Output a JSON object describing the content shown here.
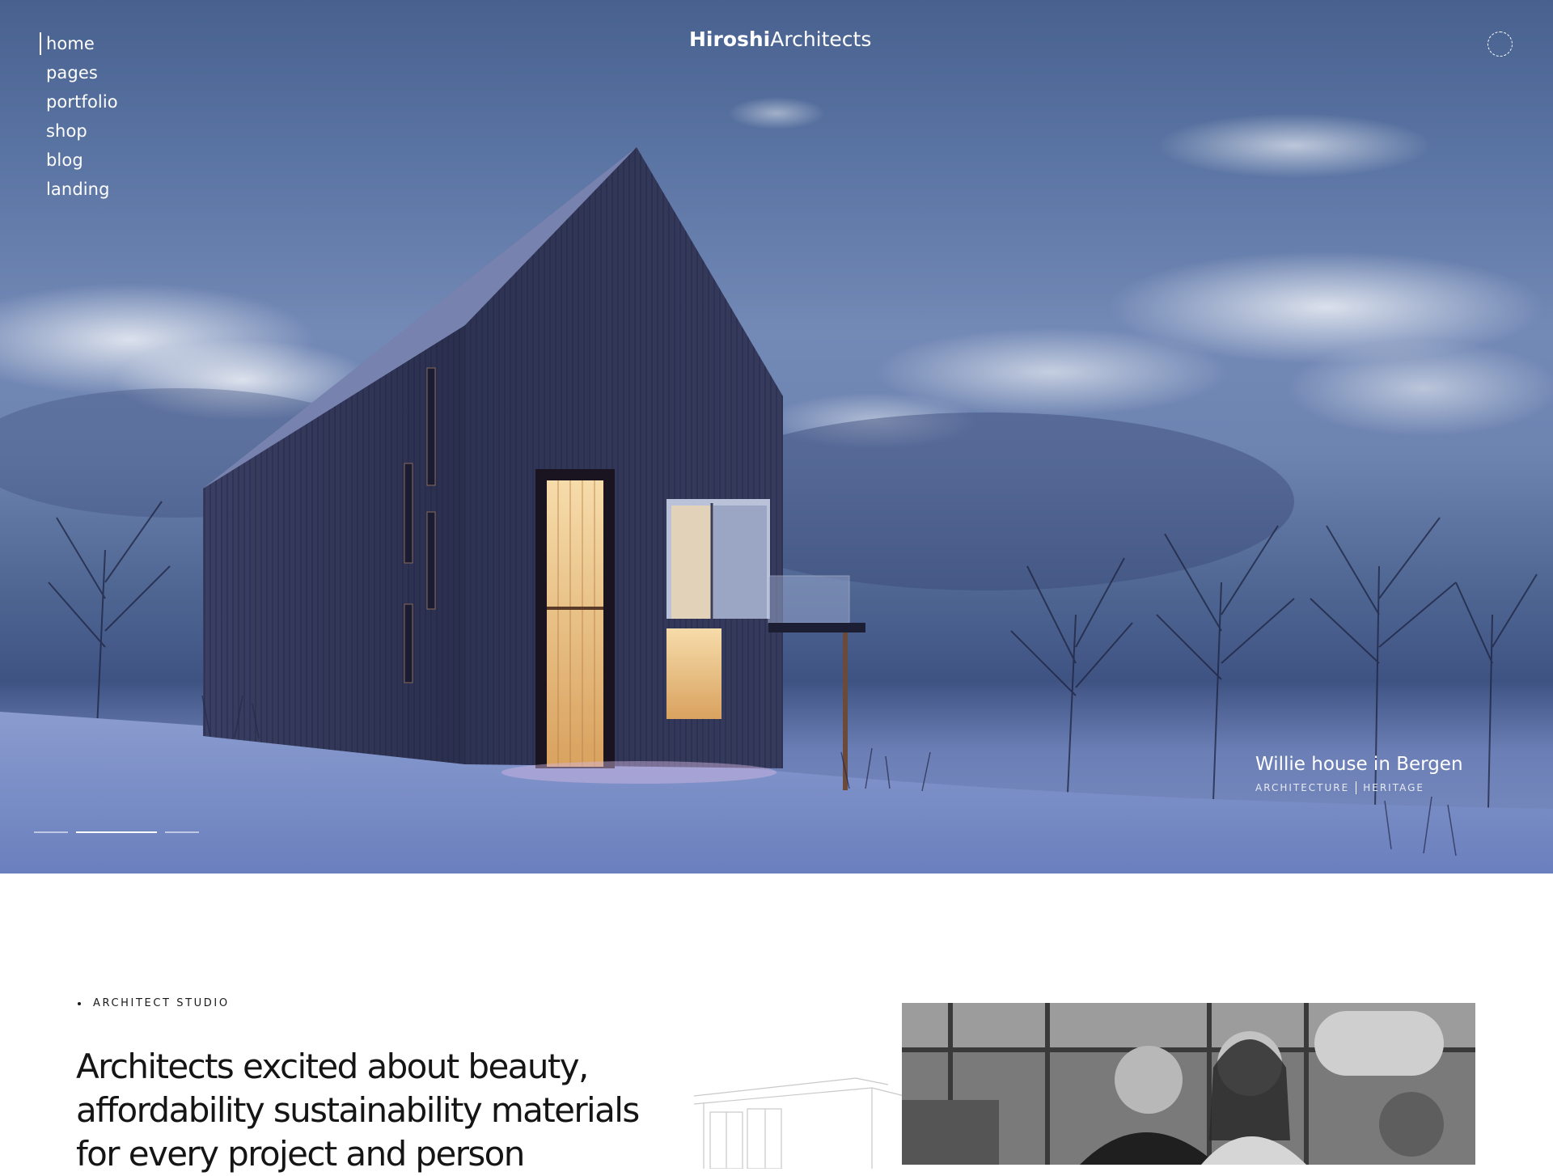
{
  "nav": {
    "items": [
      {
        "label": "home"
      },
      {
        "label": "pages"
      },
      {
        "label": "portfolio"
      },
      {
        "label": "shop"
      },
      {
        "label": "blog"
      },
      {
        "label": "landing"
      }
    ],
    "active_index": 0
  },
  "brand": {
    "bold": "Hiroshi",
    "light": "Architects"
  },
  "hero": {
    "caption_title": "Willie house in Bergen",
    "tags": [
      "ARCHITECTURE",
      "HERITAGE"
    ],
    "slides_total": 3,
    "active_slide": 2
  },
  "about": {
    "eyebrow": "ARCHITECT STUDIO",
    "headline": "Architects excited about beauty, affordability sustainability materials for every project and person"
  },
  "colors": {
    "hero_sky": "#5a74a3",
    "house": "#2a2f4d",
    "window_glow": "#f1c98a",
    "text_dark": "#151515"
  },
  "icons": {
    "menu": "dashed-circle-icon"
  }
}
